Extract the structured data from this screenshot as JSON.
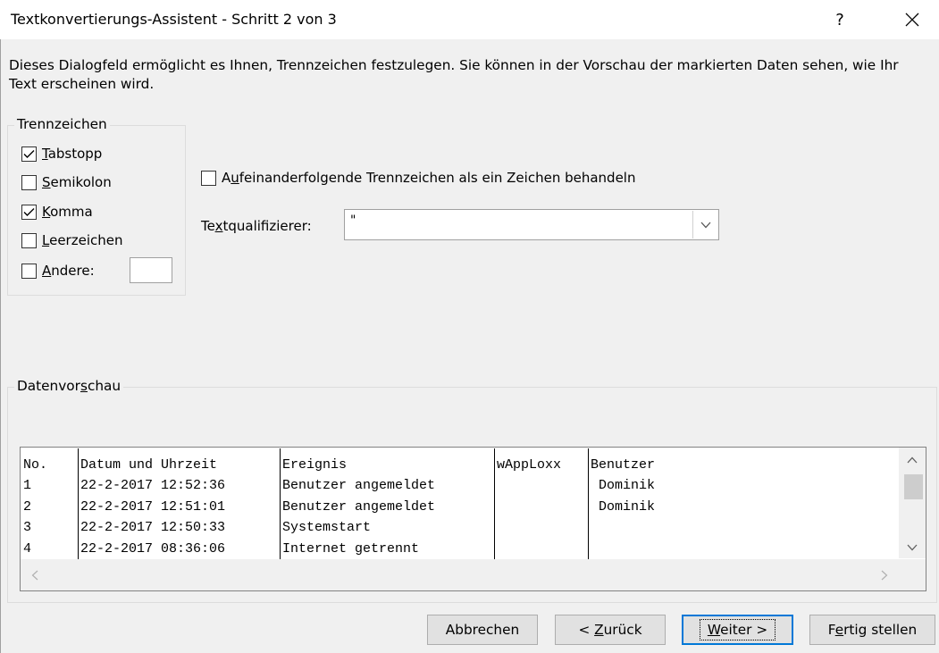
{
  "window": {
    "title": "Textkonvertierungs-Assistent - Schritt 2 von 3",
    "help_glyph": "?",
    "close_glyph": "✕"
  },
  "description": "Dieses Dialogfeld ermöglicht es Ihnen, Trennzeichen festzulegen. Sie können in der Vorschau der markierten Daten sehen, wie Ihr Text erscheinen wird.",
  "delimiters": {
    "label": "Trennzeichen",
    "tab": {
      "mnemonic": "T",
      "rest": "abstopp",
      "checked": true
    },
    "semicolon": {
      "mnemonic": "S",
      "rest": "emikolon",
      "checked": false
    },
    "comma": {
      "mnemonic": "K",
      "rest": "omma",
      "checked": true
    },
    "space": {
      "mnemonic": "L",
      "rest": "eerzeichen",
      "checked": false
    },
    "other": {
      "mnemonic": "A",
      "rest": "ndere:",
      "checked": false,
      "value": ""
    }
  },
  "consecutive": {
    "pre": "A",
    "mnemonic": "u",
    "rest": "feinanderfolgende Trennzeichen als ein Zeichen behandeln",
    "checked": false
  },
  "text_qualifier": {
    "pre": "Te",
    "mnemonic": "x",
    "rest": "tqualifizierer:",
    "value": "\""
  },
  "preview": {
    "label_pre": "Datenvor",
    "label_mnemonic": "s",
    "label_rest": "chau",
    "columns": [
      {
        "lines": [
          "No.",
          "1",
          "2",
          "3",
          "4"
        ]
      },
      {
        "lines": [
          "Datum und Uhrzeit",
          "22-2-2017 12:52:36",
          "22-2-2017 12:51:01",
          "22-2-2017 12:50:33",
          "22-2-2017 08:36:06"
        ]
      },
      {
        "lines": [
          "Ereignis",
          "Benutzer angemeldet",
          "Benutzer angemeldet",
          "Systemstart",
          "Internet getrennt"
        ]
      },
      {
        "lines": [
          "wAppLoxx",
          "",
          "",
          "",
          ""
        ]
      },
      {
        "lines": [
          "Benutzer",
          " Dominik",
          " Dominik",
          "",
          ""
        ]
      }
    ]
  },
  "buttons": {
    "cancel": "Abbrechen",
    "back_pre": "< ",
    "back_mnemonic": "Z",
    "back_rest": "urück",
    "next_mnemonic": "W",
    "next_rest": "eiter >",
    "finish_pre": "F",
    "finish_mnemonic": "e",
    "finish_rest": "rtig stellen"
  }
}
